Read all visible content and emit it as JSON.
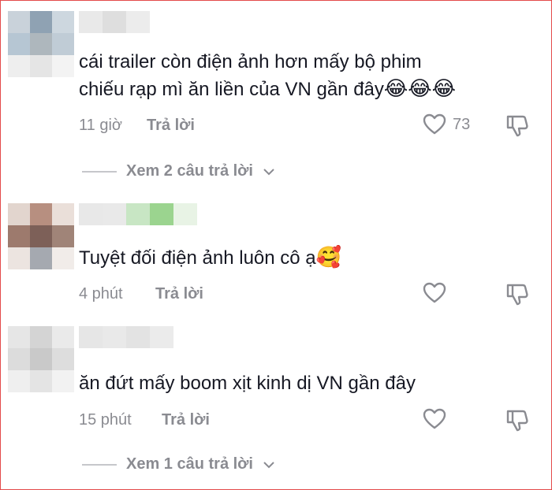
{
  "comments": [
    {
      "text_line1": "cái trailer còn điện ảnh hơn mấy bộ phim",
      "text_line2": "chiếu rạp mì ăn liền của VN gần đây",
      "emojis": "😂😂😂",
      "time": "11 giờ",
      "reply_label": "Trả lời",
      "like_count": "73",
      "view_replies_label": "Xem 2 câu trả lời"
    },
    {
      "text_line1": "Tuyệt đối điện ảnh luôn cô ạ",
      "emojis": "🥰",
      "time": "4 phút",
      "reply_label": "Trả lời"
    },
    {
      "text_line1": "ăn đứt mấy boom xịt kinh dị VN gần đây",
      "time": "15 phút",
      "reply_label": "Trả lời",
      "view_replies_label": "Xem 1 câu trả lời"
    }
  ],
  "icons": {
    "like": "heart-outline-icon",
    "dislike": "thumbs-down-outline-icon",
    "expand": "chevron-down-icon"
  },
  "colors": {
    "border": "#e34b4b",
    "muted_text": "#8a8b91",
    "text": "#161823"
  }
}
